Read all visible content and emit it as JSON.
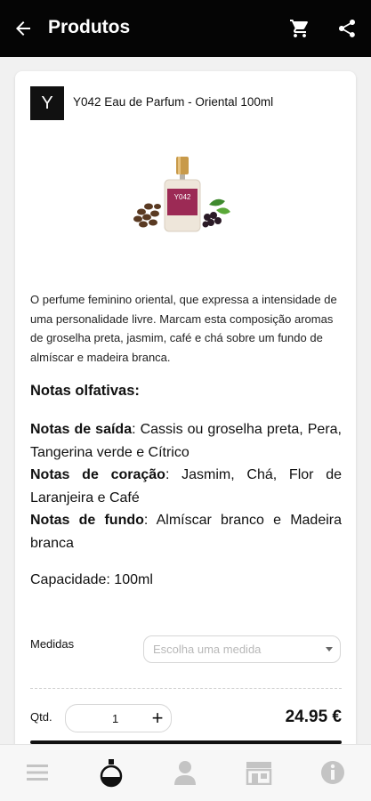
{
  "header": {
    "title": "Produtos",
    "back_icon": "arrow-left-icon",
    "cart_icon": "cart-icon",
    "share_icon": "share-icon"
  },
  "product": {
    "brand_logo_text": "Y",
    "name": "Y042 Eau de Parfum - Oriental 100ml",
    "image_label": "Y042",
    "description": "O perfume feminino oriental, que expressa a intensidade de uma personalidade livre. Marcam esta composição aromas de groselha preta, jasmim, café e chá sobre um fundo de almíscar e madeira branca.",
    "notes_title": "Notas olfativas:",
    "notes": [
      {
        "label": "Notas de saída",
        "text": ": Cassis ou groselha preta, Pera, Tangerina verde e Cítrico"
      },
      {
        "label": "Notas de coração",
        "text": ": Jasmim, Chá, Flor de Laranjeira e Café"
      },
      {
        "label": "Notas de fundo",
        "text": ": Almíscar branco e Madeira branca"
      }
    ],
    "capacity": "Capacidade: 100ml"
  },
  "medidas": {
    "label": "Medidas",
    "placeholder": "Escolha uma medida"
  },
  "quantity": {
    "label": "Qtd.",
    "value": "1",
    "plus": "+"
  },
  "price": "24.95 €",
  "colors": {
    "appbar": "#050505",
    "accent": "#111111",
    "product_label": "#9c2a55"
  },
  "bottom_nav": [
    {
      "name": "menu-icon"
    },
    {
      "name": "perfume-icon"
    },
    {
      "name": "user-icon"
    },
    {
      "name": "store-icon"
    },
    {
      "name": "info-icon"
    }
  ]
}
